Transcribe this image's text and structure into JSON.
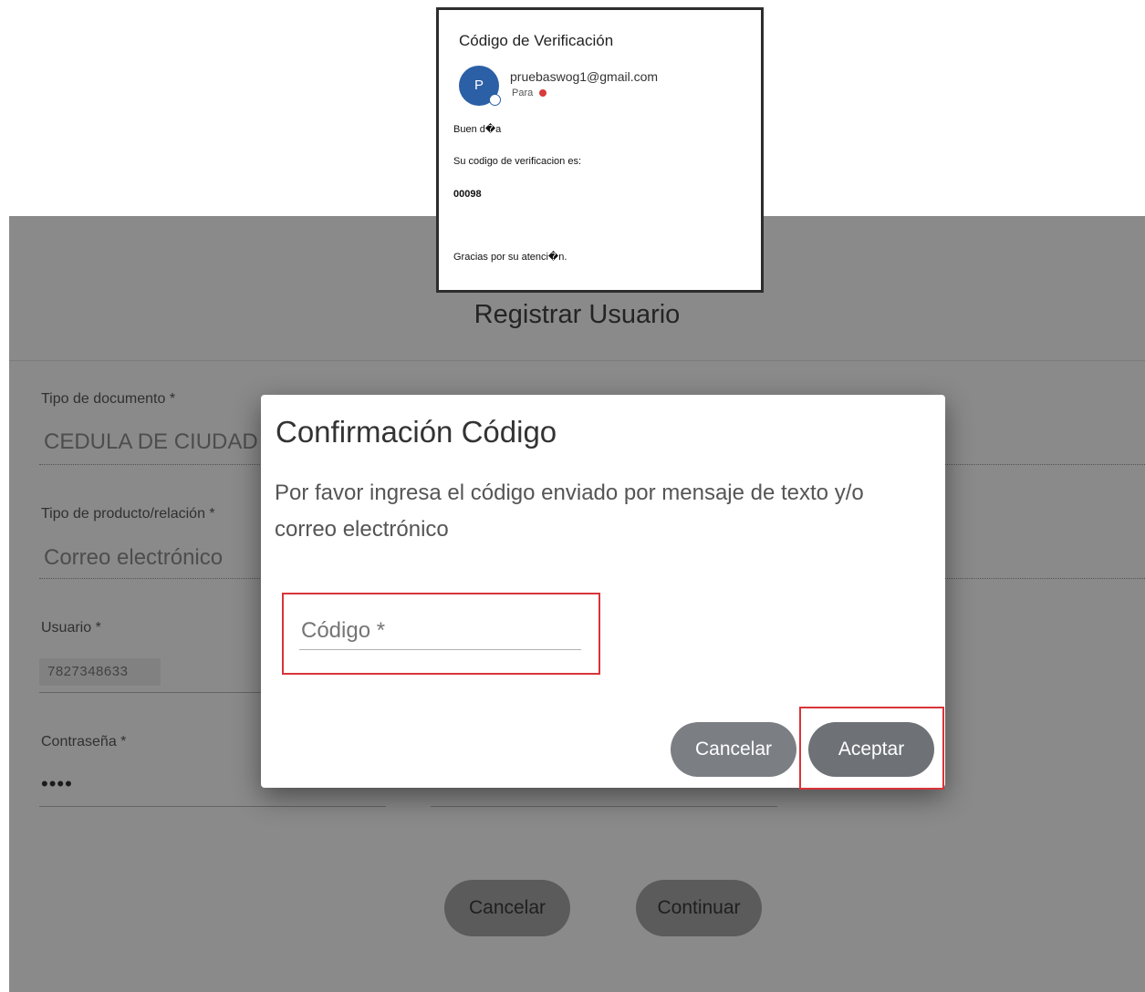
{
  "email": {
    "subject": "Código de Verificación",
    "avatar_letter": "P",
    "sender": "pruebaswog1@gmail.com",
    "to_label": "Para",
    "greeting": "Buen d�a",
    "intro": "Su codigo de verificacion es:",
    "code": "00098",
    "closing": "Gracias por su atenci�n."
  },
  "form": {
    "title": "Registrar Usuario",
    "doc_type_label": "Tipo de documento *",
    "doc_type_value": "CEDULA DE CIUDAD",
    "product_label": "Tipo de producto/relación *",
    "product_value": "Correo electrónico",
    "user_label": "Usuario *",
    "user_value": "7827348633",
    "password_label": "Contraseña *",
    "password_value": "••••",
    "cancel_label": "Cancelar",
    "continue_label": "Continuar"
  },
  "modal": {
    "title": "Confirmación Código",
    "message": "Por favor ingresa el código enviado por mensaje de texto y/o correo electrónico",
    "code_placeholder": "Código *",
    "cancel_label": "Cancelar",
    "accept_label": "Aceptar"
  },
  "colors": {
    "highlight": "#d9343a",
    "avatar": "#2b5fa6",
    "button": "#6e7276"
  }
}
